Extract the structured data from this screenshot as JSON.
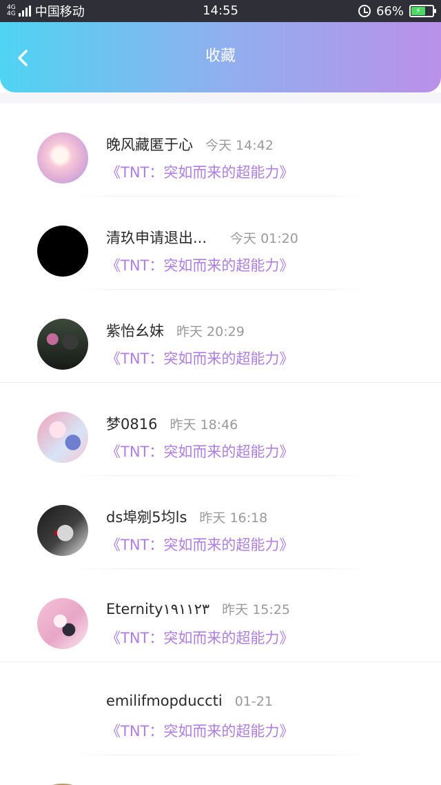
{
  "status_bar": {
    "network_top": "4G",
    "network_bottom": "4G",
    "carrier": "中国移动",
    "time": "14:55",
    "battery": "66%",
    "icons": [
      "signal-icon",
      "alarm-icon",
      "battery-charging-icon"
    ]
  },
  "header": {
    "title": "收藏",
    "back_icon": "chevron-left-icon",
    "gradient": [
      "#4fd4f2",
      "#bb90e9"
    ]
  },
  "favorites": [
    {
      "name": "晚风藏匿于心",
      "time": "今天 14:42",
      "work": "《TNT：突如而来的超能力》"
    },
    {
      "name": "清玖申请退出...",
      "time": "今天 01:20",
      "work": "《TNT：突如而来的超能力》"
    },
    {
      "name": "紫怡幺妹",
      "time": "昨天 20:29",
      "work": "《TNT：突如而来的超能力》"
    },
    {
      "name": "梦0816",
      "time": "昨天 18:46",
      "work": "《TNT：突如而来的超能力》"
    },
    {
      "name": "ds埠剜5均ls",
      "time": "昨天 16:18",
      "work": "《TNT：突如而来的超能力》"
    },
    {
      "name": "Eternity۱۹۱۱۲۳",
      "time": "昨天 15:25",
      "work": "《TNT：突如而来的超能力》"
    },
    {
      "name": "emilifmopduccti",
      "time": "01-21",
      "work": "《TNT：突如而来的超能力》"
    }
  ],
  "colors": {
    "work_title": "#b07ee0",
    "name": "#2a2a2a",
    "time": "#9a9a9a"
  }
}
